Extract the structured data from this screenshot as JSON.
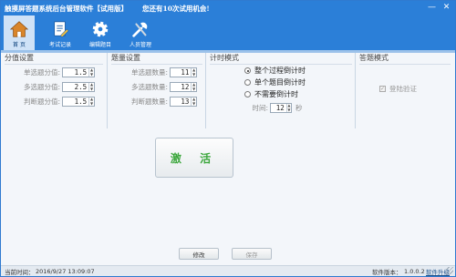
{
  "window": {
    "title": "触摸屏答题系统后台管理软件【试用版】",
    "trial_notice": "您还有10次试用机会!",
    "min_label": "—",
    "close_label": "✕"
  },
  "toolbar": {
    "items": [
      {
        "label": "首 页",
        "icon": "home-icon"
      },
      {
        "label": "考试记录",
        "icon": "exam-record-icon"
      },
      {
        "label": "编辑题目",
        "icon": "gear-icon"
      },
      {
        "label": "人员管理",
        "icon": "tools-icon"
      }
    ]
  },
  "score_settings": {
    "title": "分值设置",
    "rows": [
      {
        "label": "单选题分值:",
        "value": "1.5"
      },
      {
        "label": "多选题分值:",
        "value": "2.5"
      },
      {
        "label": "判断题分值:",
        "value": "1.5"
      }
    ]
  },
  "count_settings": {
    "title": "题量设置",
    "rows": [
      {
        "label": "单选题数量:",
        "value": "11"
      },
      {
        "label": "多选题数量:",
        "value": "12"
      },
      {
        "label": "判断题数量:",
        "value": "13"
      }
    ]
  },
  "timer_mode": {
    "title": "计时模式",
    "options": [
      {
        "label": "整个过程倒计时",
        "selected": true
      },
      {
        "label": "单个题目倒计时",
        "selected": false
      },
      {
        "label": "不需要倒计时",
        "selected": false
      }
    ],
    "time_label": "时间:",
    "time_value": "12",
    "time_unit": "秒"
  },
  "answer_mode": {
    "title": "答题模式",
    "checkbox_label": "登陆验证",
    "checked": true
  },
  "activate_label": "激 活",
  "modify_label": "修改",
  "save_label": "保存",
  "status": {
    "time_label": "当前时间：",
    "time_value": "2016/9/27 13:09:07",
    "version_label": "软件版本：",
    "version_value": "1.0.0.2",
    "update_link": "软件升级"
  },
  "colors": {
    "accent": "#2b7fd8",
    "activate_text": "#3aa63a"
  }
}
